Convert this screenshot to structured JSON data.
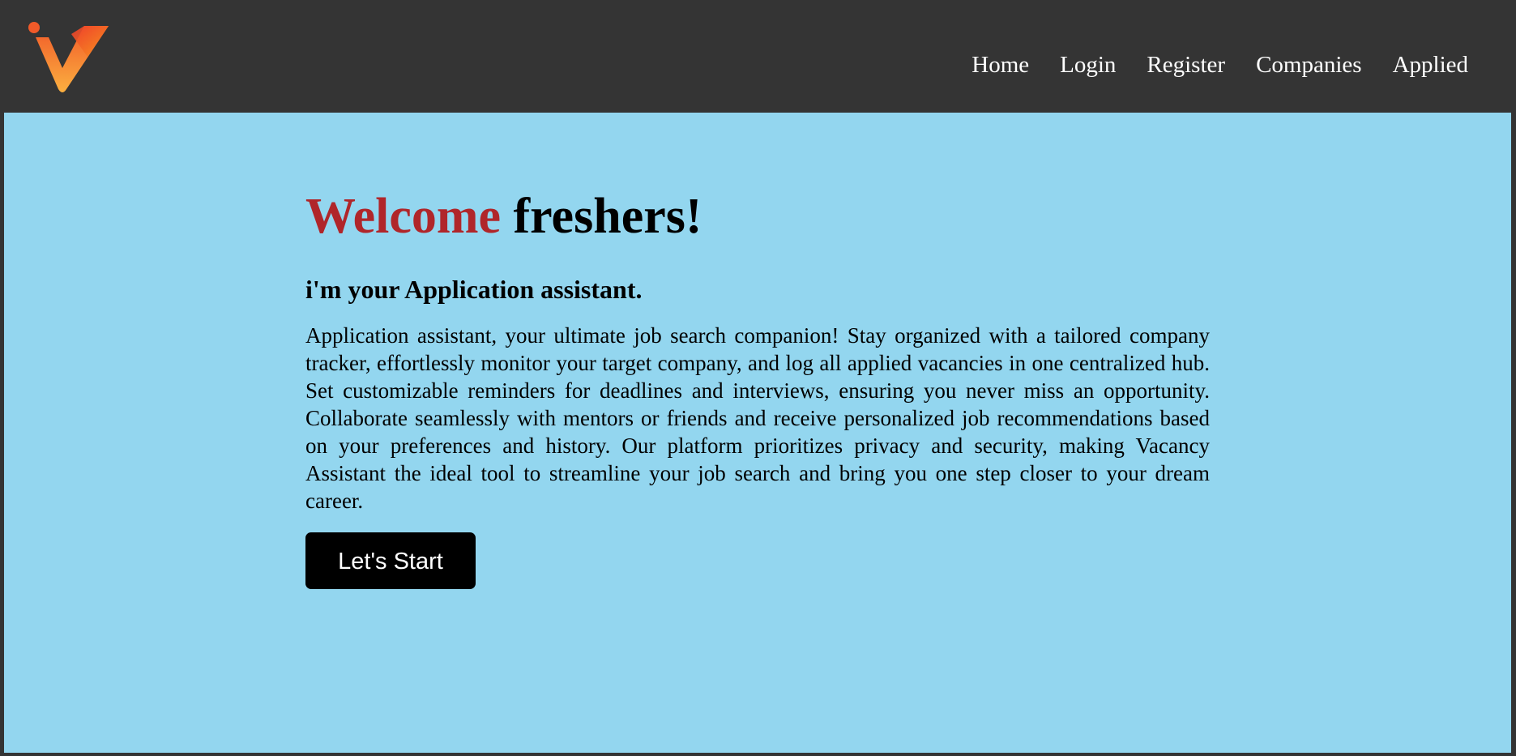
{
  "nav": {
    "items": [
      {
        "label": "Home"
      },
      {
        "label": "Login"
      },
      {
        "label": "Register"
      },
      {
        "label": "Companies"
      },
      {
        "label": "Applied"
      }
    ]
  },
  "logo": {
    "icon": "v-logo-icon"
  },
  "hero": {
    "welcome_word": "Welcome",
    "welcome_rest": " freshers!",
    "subheading": "i'm your Application assistant.",
    "description": "Application assistant, your ultimate job search companion! Stay organized with a tailored company tracker, effortlessly monitor your target company, and log all applied vacancies in one centralized hub. Set customizable reminders for deadlines and interviews, ensuring you never miss an opportunity. Collaborate seamlessly with mentors or friends and receive personalized job recommendations based on your preferences and history. Our platform prioritizes privacy and security, making Vacancy Assistant the ideal tool to streamline your job search and bring you one step closer to your dream career.",
    "button_label": "Let's Start"
  },
  "colors": {
    "navbar_bg": "#343434",
    "main_bg": "#93d6ef",
    "accent": "#b0262a",
    "logo_gradient_start": "#f26b2a",
    "logo_gradient_end": "#fbb23b"
  }
}
